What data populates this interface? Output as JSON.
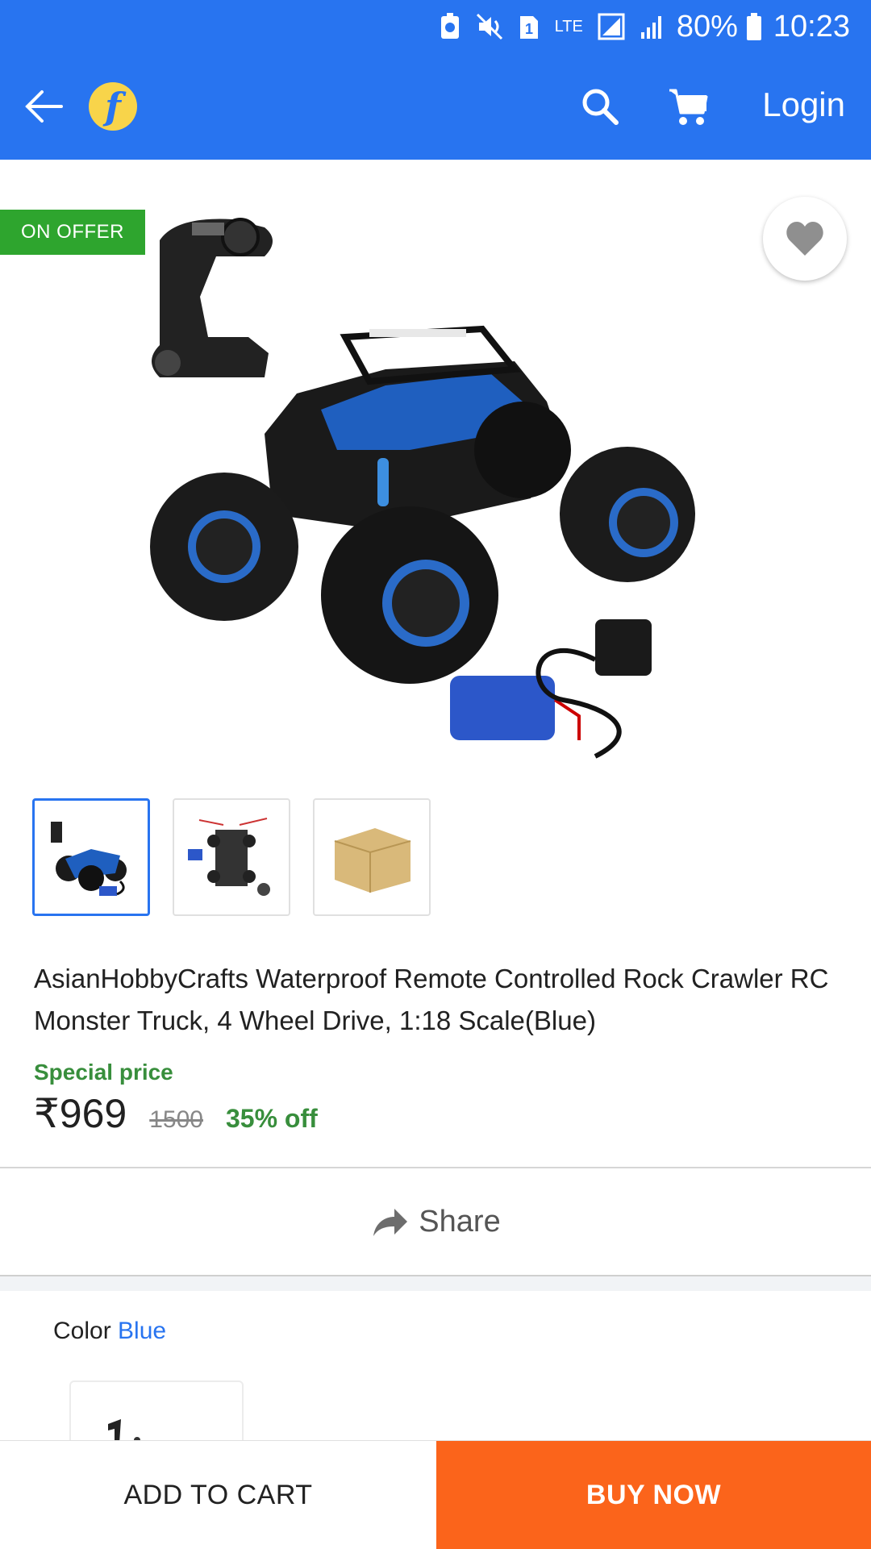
{
  "status_bar": {
    "battery_percent": "80%",
    "time": "10:23",
    "network": "LTE",
    "sim": "1"
  },
  "header": {
    "login_label": "Login",
    "logo_letter": "f"
  },
  "product": {
    "badge": "ON OFFER",
    "title": "AsianHobbyCrafts Waterproof Remote Controlled Rock Crawler RC Monster Truck, 4 Wheel Drive, 1:18 Scale(Blue)",
    "special_price_label": "Special price",
    "price": "₹969",
    "mrp": "1500",
    "discount": "35% off",
    "thumbnails": [
      "truck-with-remote",
      "parts-diagram",
      "packaging-box"
    ],
    "selected_thumbnail": 0
  },
  "share": {
    "label": "Share"
  },
  "options": {
    "color_label": "Color",
    "color_value": "Blue"
  },
  "actions": {
    "add_to_cart": "ADD TO CART",
    "buy_now": "BUY NOW"
  },
  "colors": {
    "brand_blue": "#2874f0",
    "offer_green": "#2ea52e",
    "price_green": "#388e3c",
    "buy_orange": "#fb641b"
  }
}
